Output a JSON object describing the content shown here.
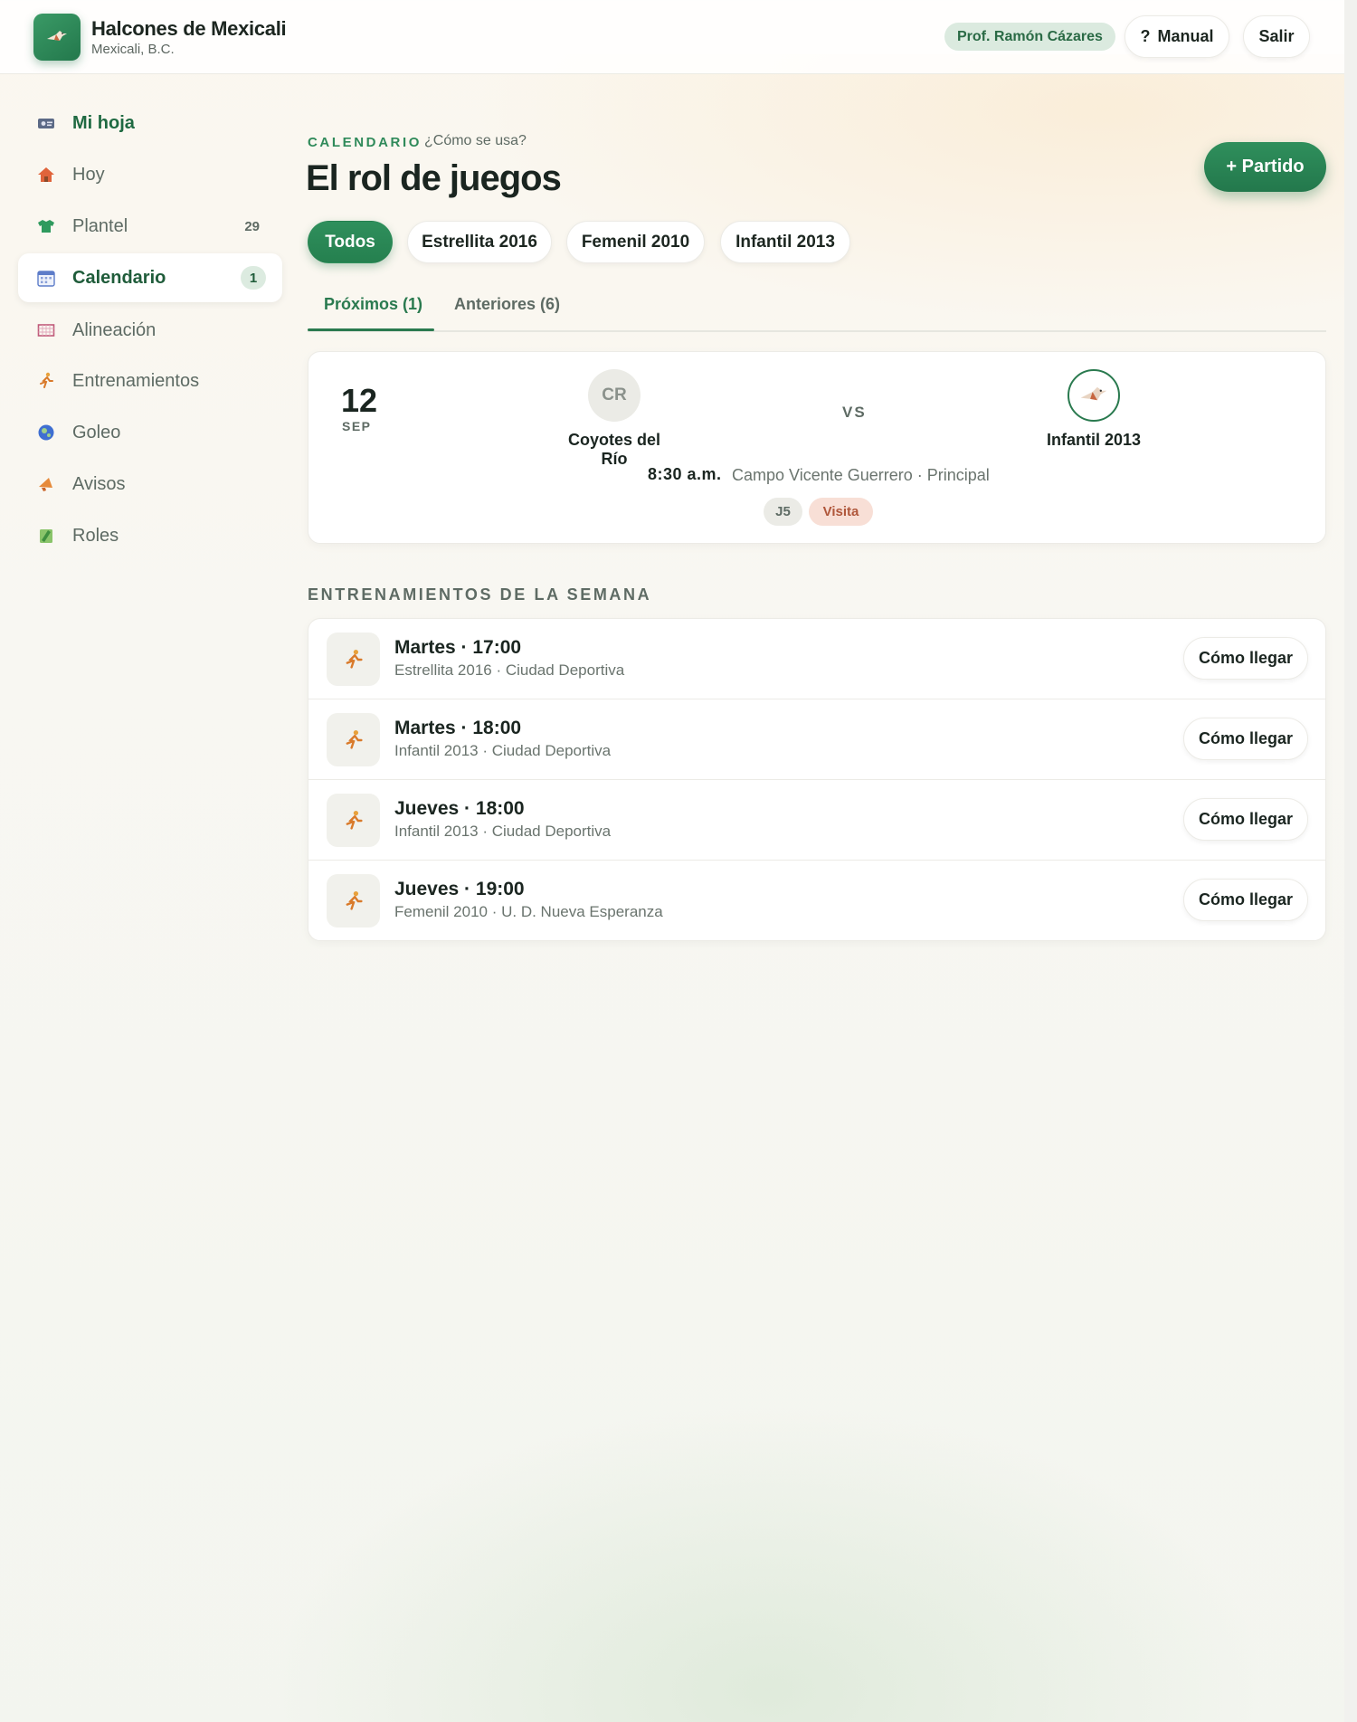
{
  "header": {
    "club_name": "Halcones de Mexicali",
    "club_location": "Mexicali, B.C.",
    "user": "Prof. Ramón Cázares",
    "manual_icon": "?",
    "manual_label": "Manual",
    "logout_label": "Salir"
  },
  "sidebar": {
    "items": [
      {
        "label": "Mi hoja",
        "icon": "id-card-icon"
      },
      {
        "label": "Hoy",
        "icon": "house-icon"
      },
      {
        "label": "Plantel",
        "icon": "jersey-icon",
        "count": "29"
      },
      {
        "label": "Calendario",
        "icon": "calendar-icon",
        "count": "1"
      },
      {
        "label": "Alineación",
        "icon": "goal-net-icon"
      },
      {
        "label": "Entrenamientos",
        "icon": "runner-icon"
      },
      {
        "label": "Goleo",
        "icon": "ball-icon"
      },
      {
        "label": "Avisos",
        "icon": "megaphone-icon"
      },
      {
        "label": "Roles",
        "icon": "roles-icon"
      }
    ]
  },
  "main": {
    "eyebrow": "CALENDARIO",
    "howto": "¿Cómo se usa?",
    "title": "El rol de juegos",
    "add_button": "+ Partido",
    "filters": [
      "Todos",
      "Estrellita 2016",
      "Femenil 2010",
      "Infantil 2013"
    ],
    "tabs": [
      "Próximos (1)",
      "Anteriores (6)"
    ],
    "match": {
      "day": "12",
      "month": "SEP",
      "home_initials": "CR",
      "home_name": "Coyotes del Río",
      "vs": "VS",
      "away_name": "Infantil 2013",
      "time": "8:30 a.m.",
      "place": "Campo Vicente Guerrero · Principal",
      "round": "J5",
      "condition": "Visita"
    },
    "trainings_title": "ENTRENAMIENTOS DE LA SEMANA",
    "trainings": [
      {
        "title": "Martes · 17:00",
        "sub": "Estrellita 2016 · Ciudad Deportiva",
        "button": "Cómo llegar"
      },
      {
        "title": "Martes · 18:00",
        "sub": "Infantil 2013 · Ciudad Deportiva",
        "button": "Cómo llegar"
      },
      {
        "title": "Jueves · 18:00",
        "sub": "Infantil 2013 · Ciudad Deportiva",
        "button": "Cómo llegar"
      },
      {
        "title": "Jueves · 19:00",
        "sub": "Femenil 2010 · U. D. Nueva Esperanza",
        "button": "Cómo llegar"
      }
    ]
  },
  "colors": {
    "accent": "#2a7a4f",
    "accent_light": "#dbeadf",
    "visita": "#b0573b"
  }
}
